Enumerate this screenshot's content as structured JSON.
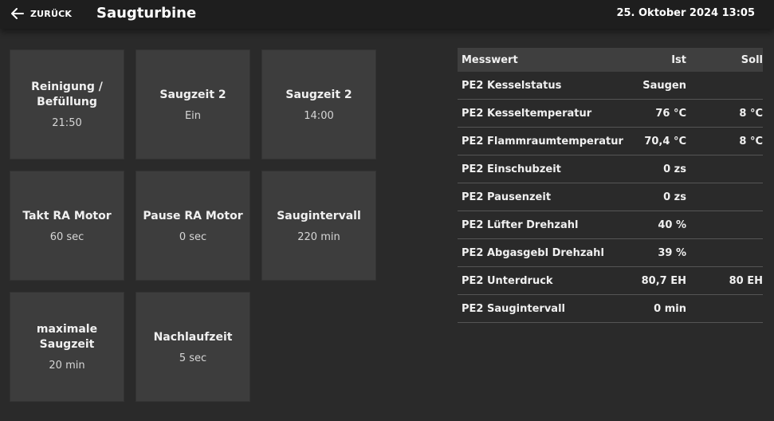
{
  "header": {
    "back_label": "ZURÜCK",
    "title": "Saugturbine",
    "datetime": "25. Oktober 2024 13:05"
  },
  "tiles": [
    {
      "label": "Reinigung / Befüllung",
      "value": "21:50"
    },
    {
      "label": "Saugzeit 2",
      "value": "Ein"
    },
    {
      "label": "Saugzeit 2",
      "value": "14:00"
    },
    {
      "label": "Takt RA Motor",
      "value": "60 sec"
    },
    {
      "label": "Pause RA Motor",
      "value": "0 sec"
    },
    {
      "label": "Saugintervall",
      "value": "220 min"
    },
    {
      "label": "maximale Saugzeit",
      "value": "20 min"
    },
    {
      "label": "Nachlaufzeit",
      "value": "5 sec"
    }
  ],
  "table": {
    "headers": {
      "name": "Messwert",
      "ist": "Ist",
      "soll": "Soll"
    },
    "rows": [
      {
        "name": "PE2 Kesselstatus",
        "ist": "Saugen",
        "soll": ""
      },
      {
        "name": "PE2 Kesseltemperatur",
        "ist": "76 °C",
        "soll": "8 °C"
      },
      {
        "name": "PE2 Flammraumtemperatur",
        "ist": "70,4 °C",
        "soll": "8 °C"
      },
      {
        "name": "PE2 Einschubzeit",
        "ist": "0 zs",
        "soll": ""
      },
      {
        "name": "PE2 Pausenzeit",
        "ist": "0 zs",
        "soll": ""
      },
      {
        "name": "PE2 Lüfter Drehzahl",
        "ist": "40 %",
        "soll": ""
      },
      {
        "name": "PE2 Abgasgebl Drehzahl",
        "ist": "39 %",
        "soll": ""
      },
      {
        "name": "PE2 Unterdruck",
        "ist": "80,7 EH",
        "soll": "80 EH"
      },
      {
        "name": "PE2 Saugintervall",
        "ist": "0 min",
        "soll": ""
      }
    ]
  }
}
